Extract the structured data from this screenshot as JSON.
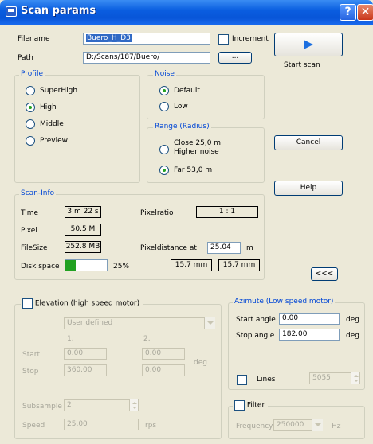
{
  "window": {
    "title": "Scan params"
  },
  "file": {
    "filename_label": "Filename",
    "filename_value": "Buero_H_D3",
    "increment_label": "Increment",
    "path_label": "Path",
    "path_value": "D:/Scans/187/Buero/",
    "browse_label": "..."
  },
  "actions": {
    "start_scan_label": "Start scan",
    "cancel_label": "Cancel",
    "help_label": "Help",
    "collapse_label": "<<<"
  },
  "profile": {
    "title": "Profile",
    "options": [
      "SuperHigh",
      "High",
      "Middle",
      "Preview"
    ],
    "selected": "High"
  },
  "noise": {
    "title": "Noise",
    "options": [
      "Default",
      "Low"
    ],
    "selected": "Default"
  },
  "range": {
    "title": "Range (Radius)",
    "close_line1": "Close  25,0 m",
    "close_line2": "Higher noise",
    "far_label": "Far  53,0 m",
    "selected": "Far"
  },
  "scan_info": {
    "title": "Scan-Info",
    "time_label": "Time",
    "time_value": "3 m 22 s",
    "pixelratio_label": "Pixelratio",
    "pixelratio_value": "1 : 1",
    "pixel_label": "Pixel",
    "pixel_value": "50.5 M",
    "filesize_label": "FileSize",
    "filesize_value": "252.8 MB",
    "pixeldistance_label": "Pixeldistance at",
    "pixeldistance_value": "25.04",
    "pixeldistance_unit": "m",
    "diskspace_label": "Disk space",
    "diskspace_percent": "25%",
    "diskspace_fraction": 0.25,
    "dist_a": "15.7 mm",
    "dist_b": "15.7 mm"
  },
  "elevation": {
    "title": "Elevation (high speed motor)",
    "mode": "User defined",
    "col1": "1.",
    "col2": "2.",
    "start_label": "Start",
    "start_1": "0.00",
    "start_2": "0.00",
    "stop_label": "Stop",
    "stop_1": "360.00",
    "stop_2": "0.00",
    "unit": "deg",
    "subsample_label": "Subsample",
    "subsample_value": "2",
    "speed_label": "Speed",
    "speed_value": "25.00",
    "speed_unit": "rps"
  },
  "azimuth": {
    "title": "Azimute (Low speed motor)",
    "start_label": "Start angle",
    "start_value": "0.00",
    "stop_label": "Stop angle",
    "stop_value": "182.00",
    "unit": "deg",
    "lines_label": "Lines",
    "lines_value": "5055"
  },
  "filter": {
    "label": "Filter",
    "frequency_label": "Frequency",
    "frequency_value": "250000",
    "frequency_unit": "Hz"
  },
  "colors": {
    "accent": "#0a5ee0",
    "progress": "#21a121",
    "play": "#1c6fe0"
  }
}
